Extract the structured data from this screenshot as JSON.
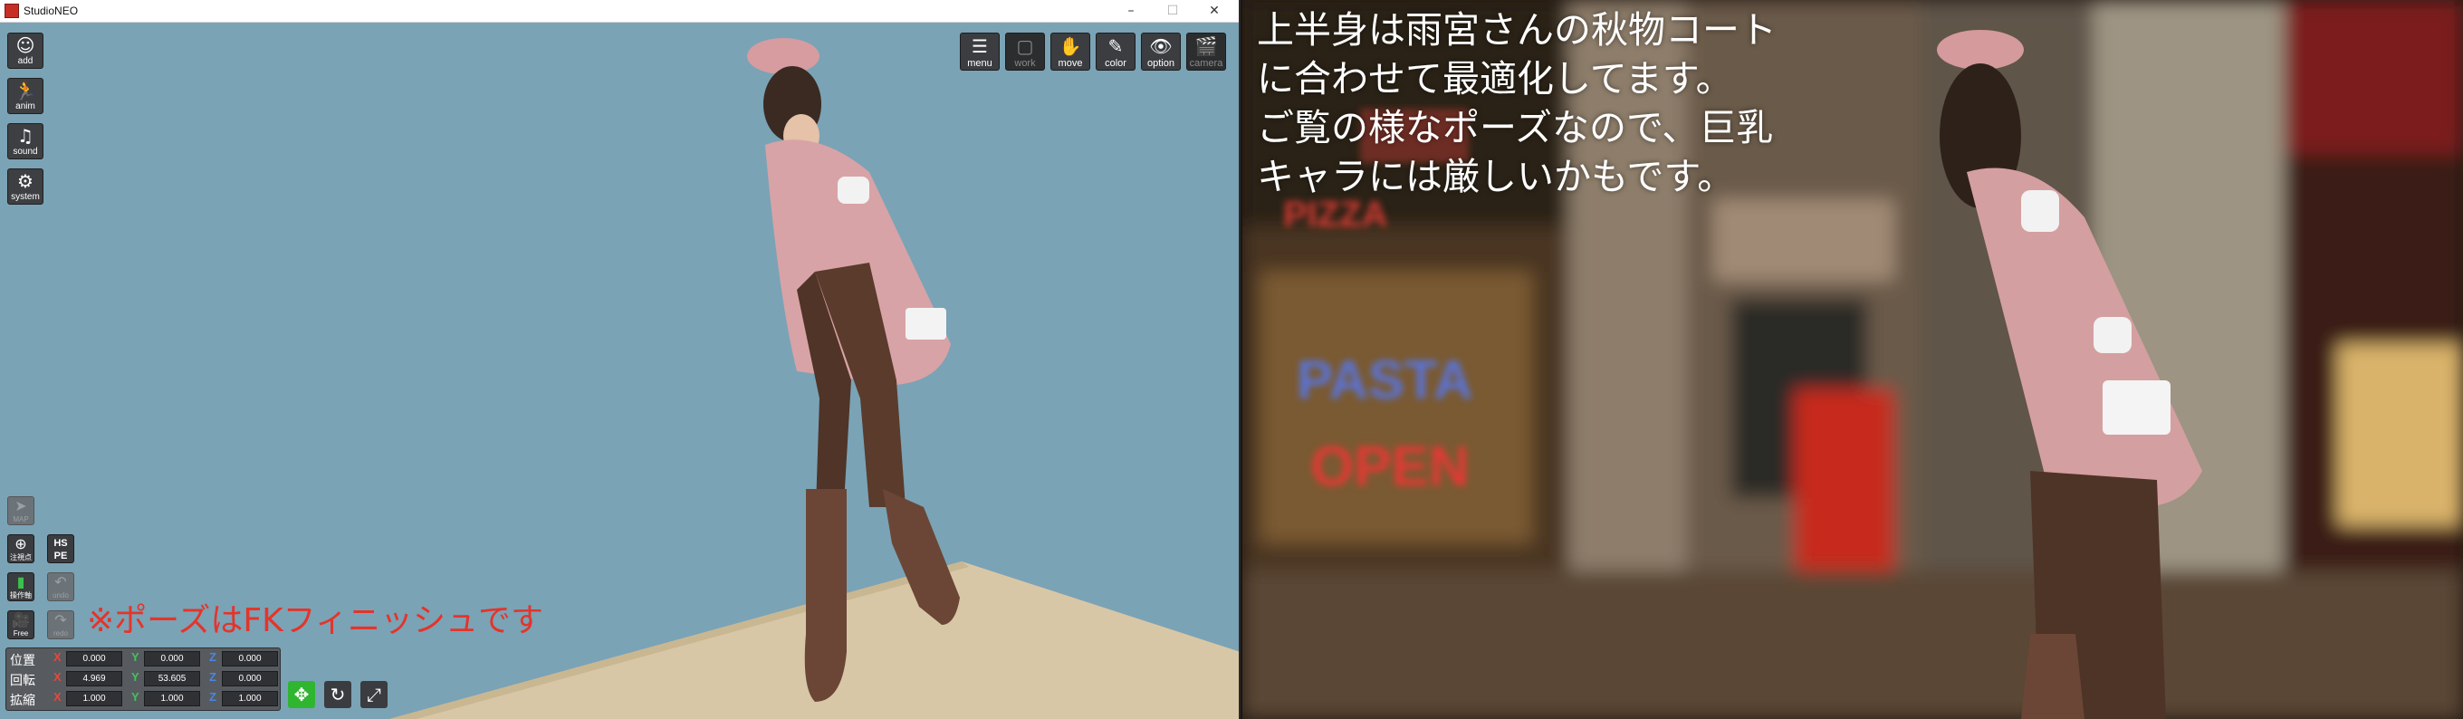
{
  "window": {
    "title": "StudioNEO",
    "controls": {
      "minimize": "–",
      "maximize": "☐",
      "close": "✕"
    }
  },
  "left_toolbar": [
    {
      "label": "add",
      "icon": "person-add-icon",
      "glyph": "☺"
    },
    {
      "label": "anim",
      "icon": "running-person-icon",
      "glyph": "🏃"
    },
    {
      "label": "sound",
      "icon": "music-note-icon",
      "glyph": "♫"
    },
    {
      "label": "system",
      "icon": "gears-icon",
      "glyph": "⚙"
    }
  ],
  "top_toolbar": [
    {
      "label": "menu",
      "icon": "menu-list-icon",
      "glyph": "☰",
      "enabled": true
    },
    {
      "label": "work",
      "icon": "workspace-icon",
      "glyph": "▢",
      "enabled": false
    },
    {
      "label": "move",
      "icon": "hand-icon",
      "glyph": "✋",
      "enabled": true
    },
    {
      "label": "color",
      "icon": "palette-icon",
      "glyph": "✎",
      "enabled": true
    },
    {
      "label": "option",
      "icon": "eye-icon",
      "glyph": "👁",
      "enabled": true
    },
    {
      "label": "camera",
      "icon": "clapperboard-icon",
      "glyph": "🎬",
      "enabled": false
    }
  ],
  "bottom_left_buttons": {
    "map": "MAP",
    "focus": "注視点",
    "hspe": "HS PE",
    "operation": "操作軸",
    "undo": "undo",
    "free": "Free",
    "redo": "redo"
  },
  "note": "※ポーズはFKフィニッシュです",
  "transform_panel": {
    "rows": [
      {
        "label": "位置",
        "x": "0.000",
        "y": "0.000",
        "z": "0.000"
      },
      {
        "label": "回転",
        "x": "4.969",
        "y": "53.605",
        "z": "0.000"
      },
      {
        "label": "拡縮",
        "x": "1.000",
        "y": "1.000",
        "z": "1.000"
      }
    ],
    "axes": {
      "x": "X",
      "y": "Y",
      "z": "Z"
    }
  },
  "gizmo_buttons": [
    {
      "icon": "move-gizmo-icon",
      "glyph": "✥",
      "color": "#2fb52f"
    },
    {
      "icon": "rotate-gizmo-icon",
      "glyph": "↻",
      "color": "#3a3c3f"
    },
    {
      "icon": "scale-gizmo-icon",
      "glyph": "⤢",
      "color": "#3a3c3f"
    }
  ],
  "caption": [
    "上半身は雨宮さんの秋物コート",
    "に合わせて最適化してます。",
    "ご覧の様なポーズなので、巨乳",
    "キャラには厳しいかもです。"
  ],
  "background_signs": {
    "pizza": "PIZZA",
    "pasta": "PASTA",
    "open": "OPEN"
  },
  "colors": {
    "viewport": "#7aa3b6",
    "floor": "#d8c7a6",
    "note": "#e5342a",
    "coat": "#d8a3a6"
  }
}
